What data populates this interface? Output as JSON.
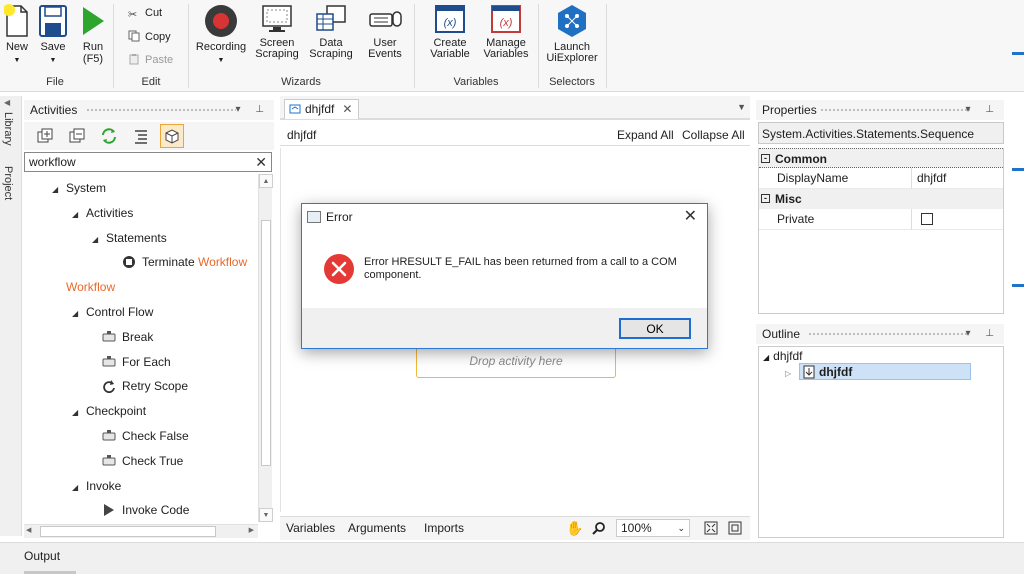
{
  "ribbon": {
    "file": {
      "group_label": "File",
      "new_label": "New",
      "save_label": "Save",
      "run_label": "Run",
      "run_shortcut": "(F5)"
    },
    "edit": {
      "group_label": "Edit",
      "cut_label": "Cut",
      "copy_label": "Copy",
      "paste_label": "Paste"
    },
    "wizards": {
      "group_label": "Wizards",
      "recording_label": "Recording",
      "screen_scraping_label": "Screen Scraping",
      "data_scraping_label": "Data Scraping",
      "user_events_label": "User Events"
    },
    "variables": {
      "group_label": "Variables",
      "create_label": "Create Variable",
      "manage_label": "Manage Variables"
    },
    "selectors": {
      "group_label": "Selectors",
      "launch_label": "Launch UiExplorer"
    }
  },
  "side_tabs": {
    "library": "Library",
    "project": "Project"
  },
  "activities": {
    "title": "Activities",
    "search_value": "workflow",
    "tree": [
      {
        "label": "System",
        "level": 1,
        "expandable": true
      },
      {
        "label": "Activities",
        "level": 2,
        "expandable": true
      },
      {
        "label": "Statements",
        "level": 3,
        "expandable": true
      },
      {
        "label": "Terminate ",
        "highlight": "Workflow",
        "level": 4,
        "icon": "terminate-icon"
      },
      {
        "label": "",
        "highlight": "Workflow",
        "level": 1,
        "expandable": false
      },
      {
        "label": "Control Flow",
        "level": 2,
        "expandable": true
      },
      {
        "label": "Break",
        "level": 3,
        "icon": "activity-icon"
      },
      {
        "label": "For Each",
        "level": 3,
        "icon": "activity-icon"
      },
      {
        "label": "Retry Scope",
        "level": 3,
        "icon": "retry-icon"
      },
      {
        "label": "Checkpoint",
        "level": 2,
        "expandable": true
      },
      {
        "label": "Check False",
        "level": 3,
        "icon": "activity-icon"
      },
      {
        "label": "Check True",
        "level": 3,
        "icon": "activity-icon"
      },
      {
        "label": "Invoke",
        "level": 2,
        "expandable": true
      },
      {
        "label": "Invoke Code",
        "level": 3,
        "icon": "play-icon"
      }
    ]
  },
  "designer": {
    "tab_label": "dhjfdf",
    "workflow_name": "dhjfdf",
    "expand_all": "Expand All",
    "collapse_all": "Collapse All",
    "drop_placeholder": "Drop activity here",
    "bottom_tabs": {
      "variables": "Variables",
      "arguments": "Arguments",
      "imports": "Imports"
    },
    "zoom": "100%"
  },
  "properties": {
    "title": "Properties",
    "type_name": "System.Activities.Statements.Sequence",
    "categories": [
      {
        "name": "Common",
        "rows": [
          {
            "name": "DisplayName",
            "value": "dhjfdf"
          }
        ]
      },
      {
        "name": "Misc",
        "rows": [
          {
            "name": "Private",
            "value": ""
          }
        ]
      }
    ]
  },
  "outline": {
    "title": "Outline",
    "root": "dhjfdf",
    "child": "dhjfdf"
  },
  "output": {
    "label": "Output"
  },
  "dialog": {
    "title": "Error",
    "message": "Error HRESULT E_FAIL has been returned from a call to a COM component.",
    "ok_label": "OK"
  },
  "colors": {
    "accent": "#1f74c9",
    "highlight": "#e8692a",
    "run_green": "#2ea52e",
    "record_red": "#d93434"
  }
}
